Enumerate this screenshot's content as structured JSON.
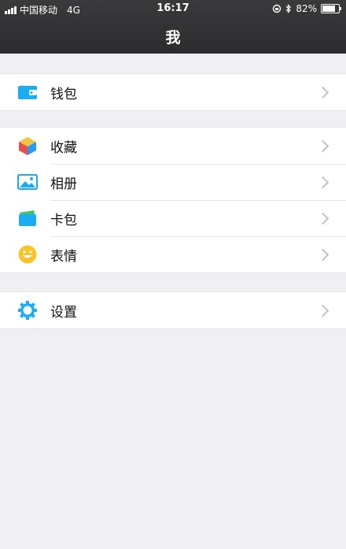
{
  "status_bar": {
    "carrier": "中国移动",
    "network": "4G",
    "time": "16:17",
    "battery": "82%",
    "battery_level": 0.82
  },
  "nav": {
    "title": "我"
  },
  "groups": [
    {
      "items": [
        {
          "label": "钱包",
          "icon": "wallet-icon"
        }
      ]
    },
    {
      "items": [
        {
          "label": "收藏",
          "icon": "favorites-cube-icon"
        },
        {
          "label": "相册",
          "icon": "album-icon"
        },
        {
          "label": "卡包",
          "icon": "card-pack-icon"
        },
        {
          "label": "表情",
          "icon": "emoji-icon"
        }
      ]
    },
    {
      "items": [
        {
          "label": "设置",
          "icon": "settings-gear-icon"
        }
      ]
    }
  ],
  "colors": {
    "accent_blue": "#1aadf4",
    "background": "#efeff4",
    "header": "#2c2c2e"
  }
}
